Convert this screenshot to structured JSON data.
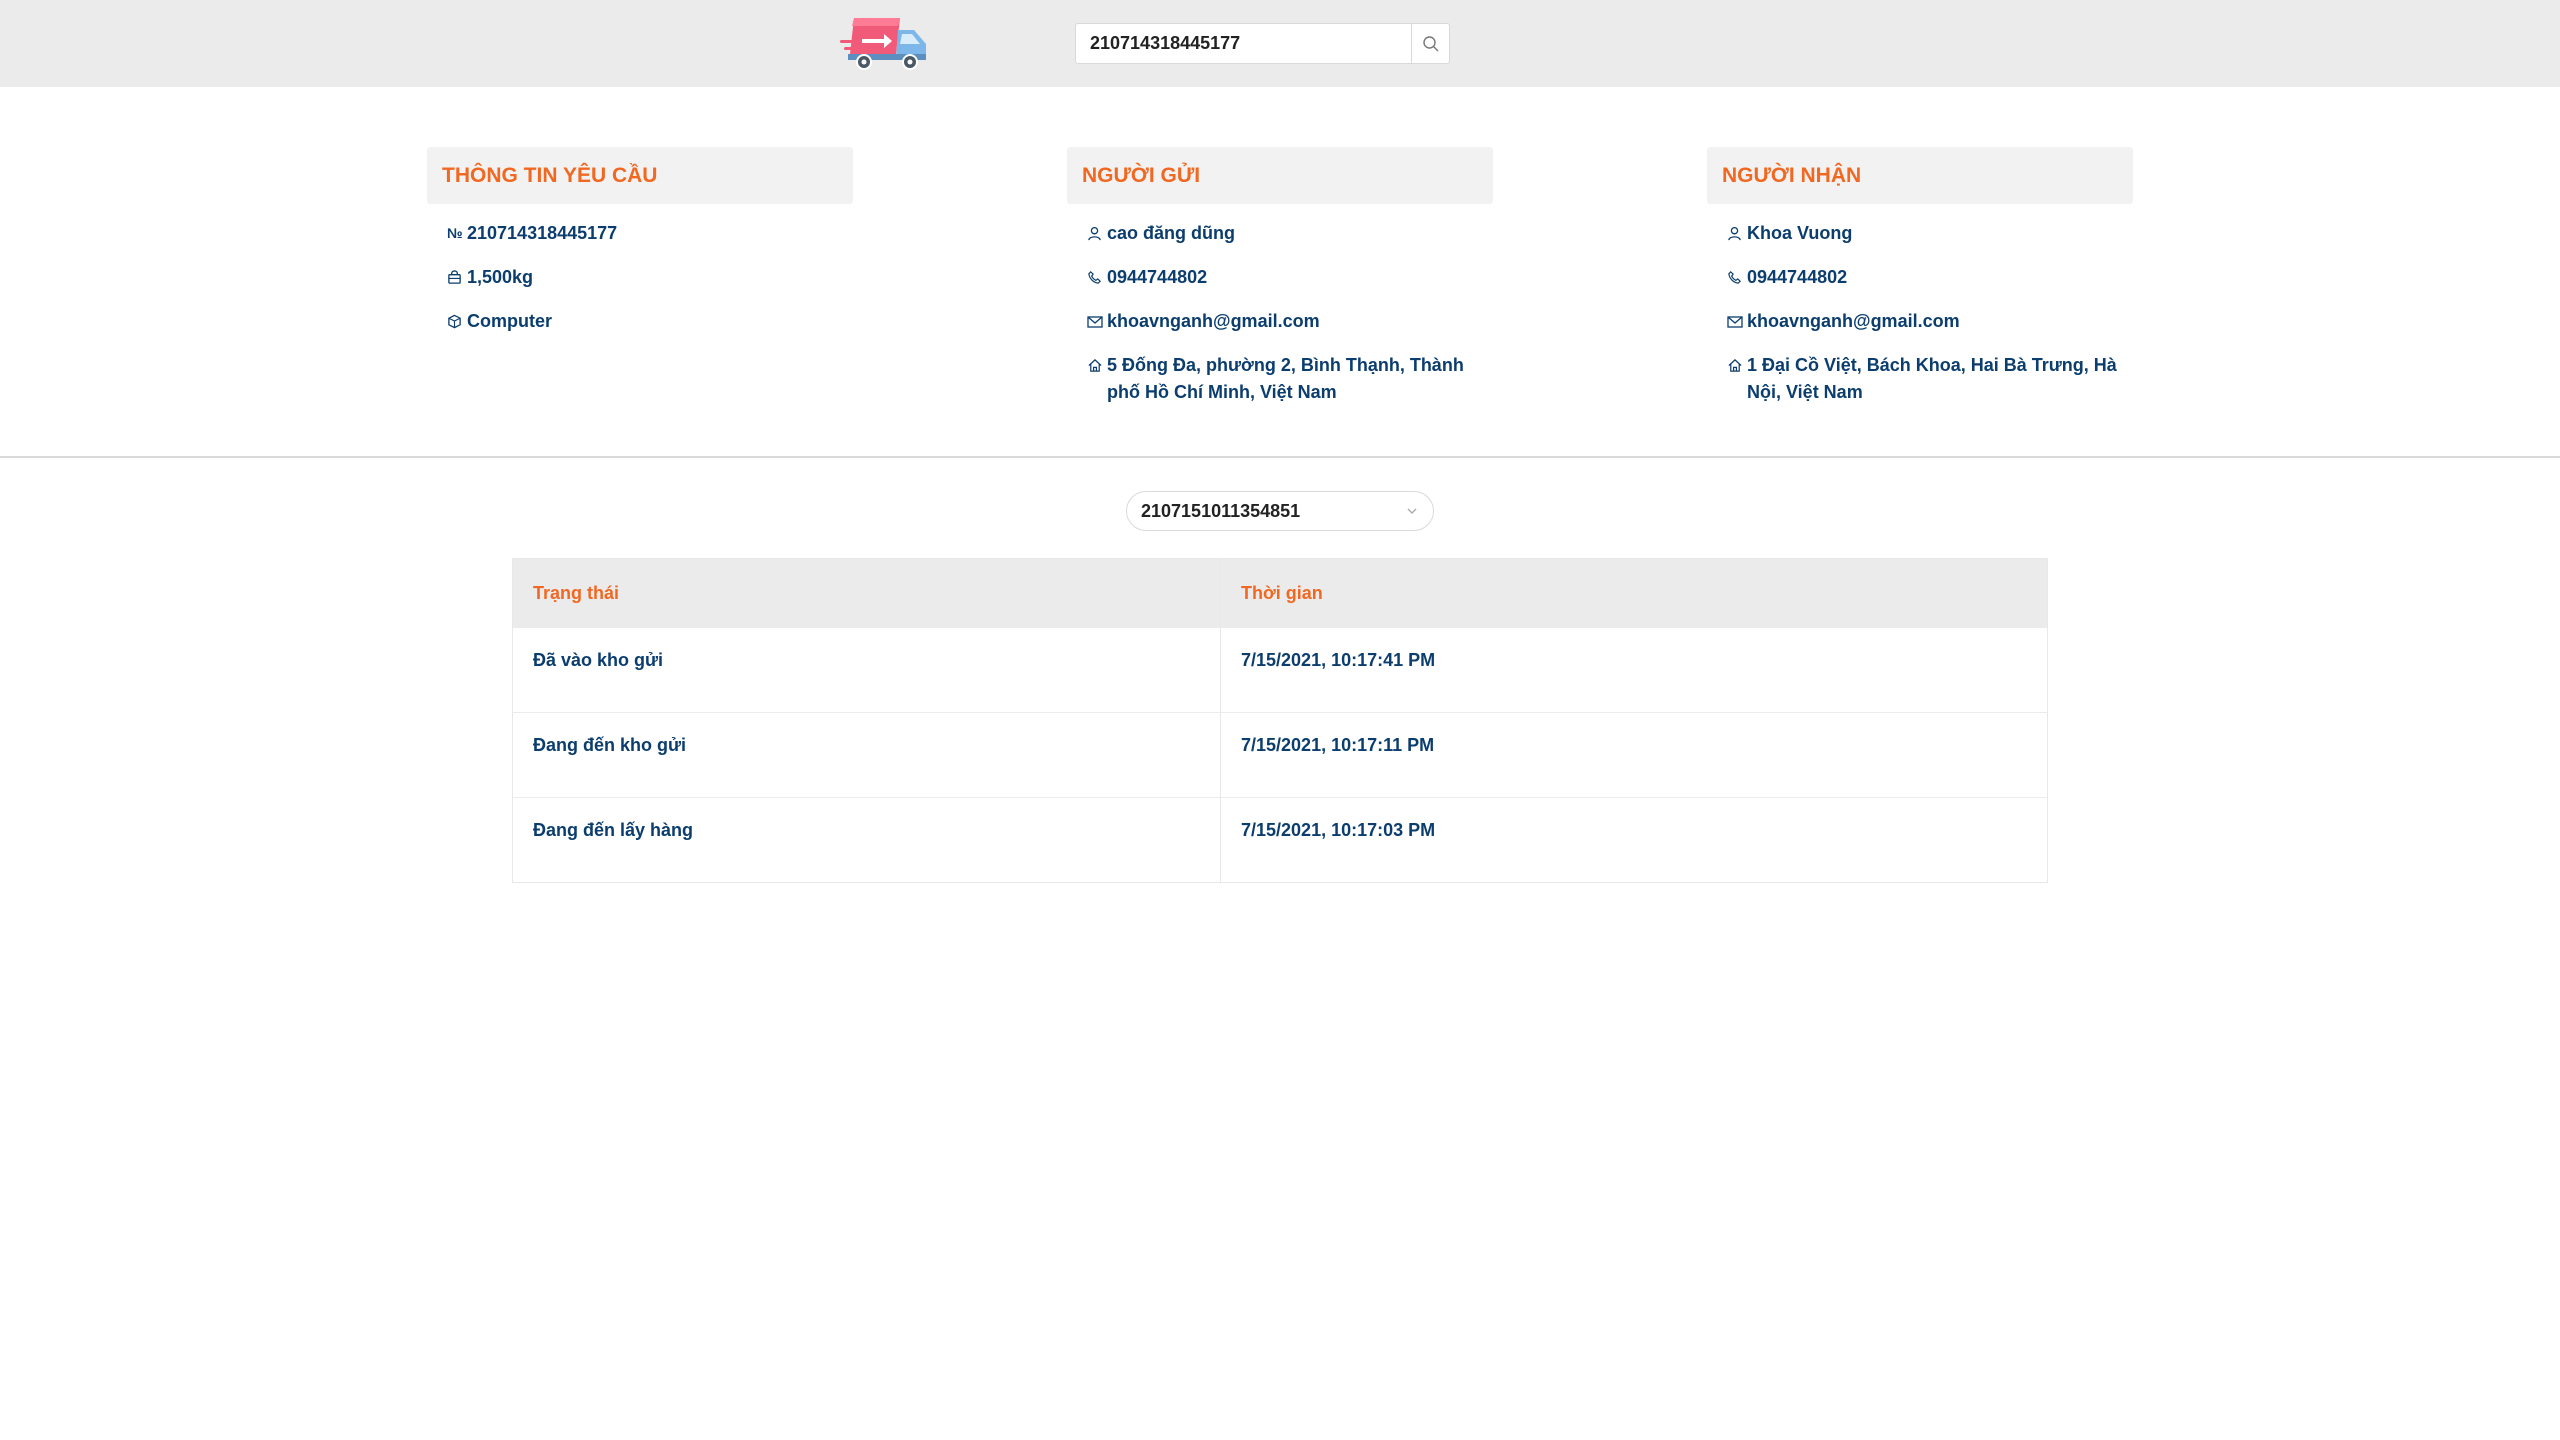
{
  "header": {
    "logo_icon": "delivery-truck-logo",
    "search_value": "210714318445177",
    "search_icon": "search-icon"
  },
  "request_info": {
    "title": "THÔNG TIN YÊU CẦU",
    "code_symbol": "№",
    "code": "210714318445177",
    "weight": "1,500kg",
    "item": "Computer"
  },
  "sender": {
    "title": "NGƯỜI GỬI",
    "name": "cao đăng dũng",
    "phone": "0944744802",
    "email": "khoavnganh@gmail.com",
    "address": "5 Đống Đa, phường 2, Bình Thạnh, Thành phố Hồ Chí Minh, Việt Nam"
  },
  "receiver": {
    "title": "NGƯỜI NHẬN",
    "name": "Khoa Vuong",
    "phone": "0944744802",
    "email": "khoavnganh@gmail.com",
    "address": "1 Đại Cồ Việt, Bách Khoa, Hai Bà Trưng, Hà Nội, Việt Nam"
  },
  "tracking": {
    "selected": "2107151011354851",
    "columns": [
      "Trạng thái",
      "Thời gian"
    ],
    "rows": [
      {
        "status": "Đã vào kho gửi",
        "time": "7/15/2021, 10:17:41 PM"
      },
      {
        "status": "Đang đến kho gửi",
        "time": "7/15/2021, 10:17:11 PM"
      },
      {
        "status": "Đang đến lấy hàng",
        "time": "7/15/2021, 10:17:03 PM"
      }
    ]
  },
  "colors": {
    "accent": "#f16822",
    "text": "#0b3d6e",
    "header_bg": "#ebebeb"
  }
}
